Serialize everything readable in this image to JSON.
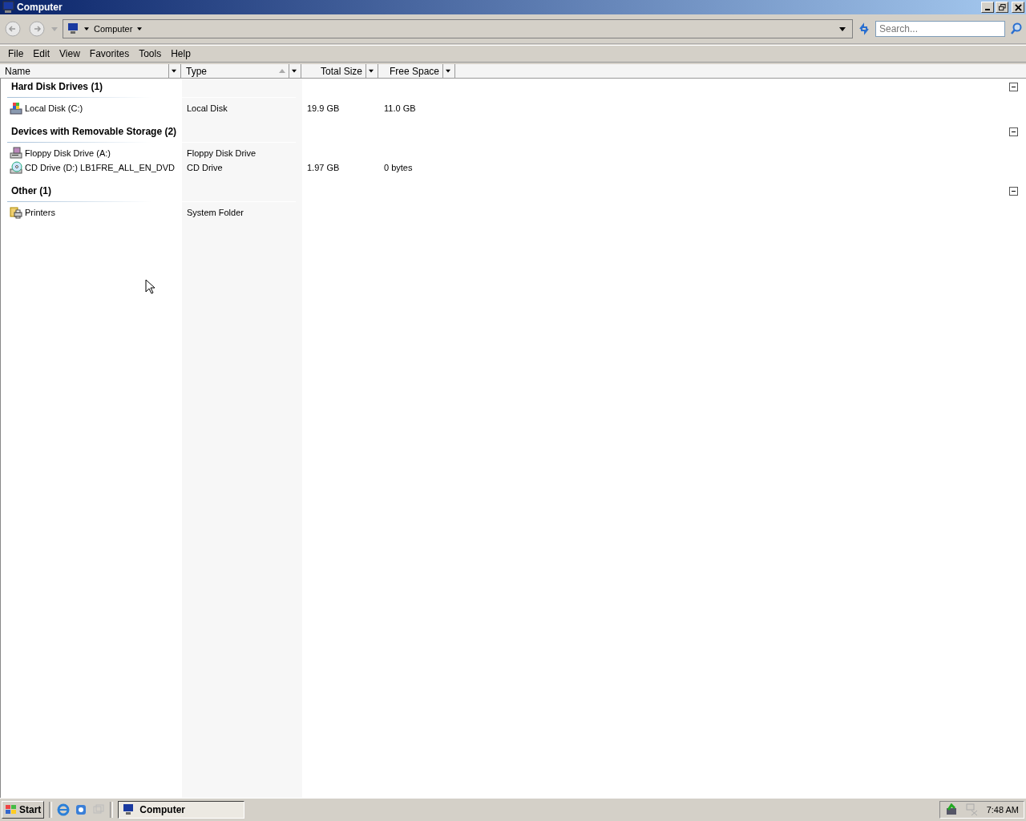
{
  "window": {
    "title": "Computer"
  },
  "address_bar": {
    "location": "Computer",
    "search": {
      "placeholder": "Search..."
    }
  },
  "menu": [
    "File",
    "Edit",
    "View",
    "Favorites",
    "Tools",
    "Help"
  ],
  "columns": [
    {
      "label": "Name",
      "sorted": false
    },
    {
      "label": "Type",
      "sorted": true
    },
    {
      "label": "Total Size",
      "sorted": false
    },
    {
      "label": "Free Space",
      "sorted": false
    }
  ],
  "groups": [
    {
      "title": "Hard Disk Drives (1)",
      "expanded": true,
      "items": [
        {
          "kind": "disk",
          "name": "Local Disk (C:)",
          "type": "Local Disk",
          "total": "19.9 GB",
          "free": "11.0 GB"
        }
      ]
    },
    {
      "title": "Devices with Removable Storage (2)",
      "expanded": true,
      "items": [
        {
          "kind": "floppy",
          "name": "Floppy Disk Drive (A:)",
          "type": "Floppy Disk Drive"
        },
        {
          "kind": "cd",
          "name": "CD Drive (D:) LB1FRE_ALL_EN_DVD",
          "type": "CD Drive",
          "total": "1.97 GB",
          "free": "0 bytes"
        }
      ]
    },
    {
      "title": "Other (1)",
      "expanded": true,
      "items": [
        {
          "kind": "printers",
          "name": "Printers",
          "type": "System Folder"
        }
      ]
    }
  ],
  "taskbar": {
    "start": "Start",
    "tasks": [
      {
        "label": "Computer",
        "selected": true
      }
    ],
    "clock": "7:48 AM"
  }
}
